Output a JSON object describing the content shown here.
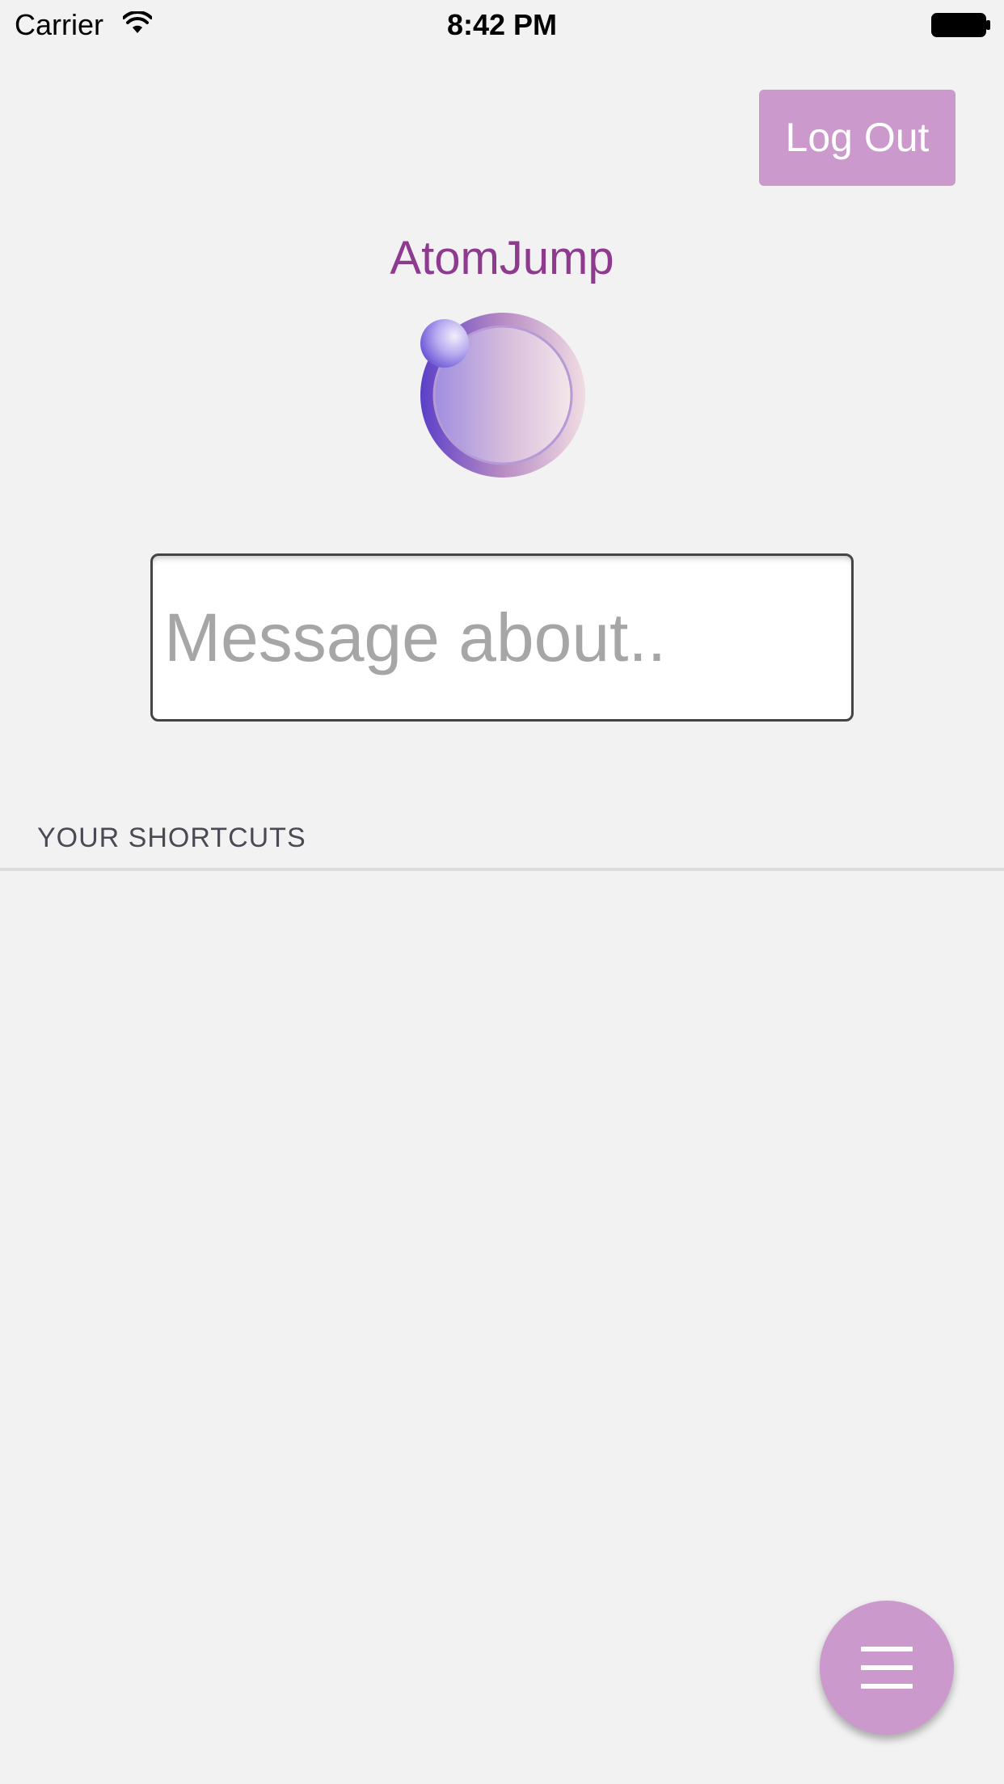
{
  "status_bar": {
    "carrier": "Carrier",
    "time": "8:42 PM",
    "wifi_icon": "wifi-icon",
    "battery_icon": "battery-icon"
  },
  "header": {
    "logout_label": "Log Out"
  },
  "app": {
    "title": "AtomJump",
    "logo_icon": "atomjump-logo"
  },
  "search": {
    "placeholder": "Message about..",
    "value": ""
  },
  "shortcuts": {
    "heading": "YOUR SHORTCUTS",
    "items": []
  },
  "fab": {
    "icon": "hamburger-menu-icon"
  },
  "colors": {
    "accent": "#cc99cc",
    "title": "#8e3a8e",
    "background": "#f2f2f3"
  }
}
